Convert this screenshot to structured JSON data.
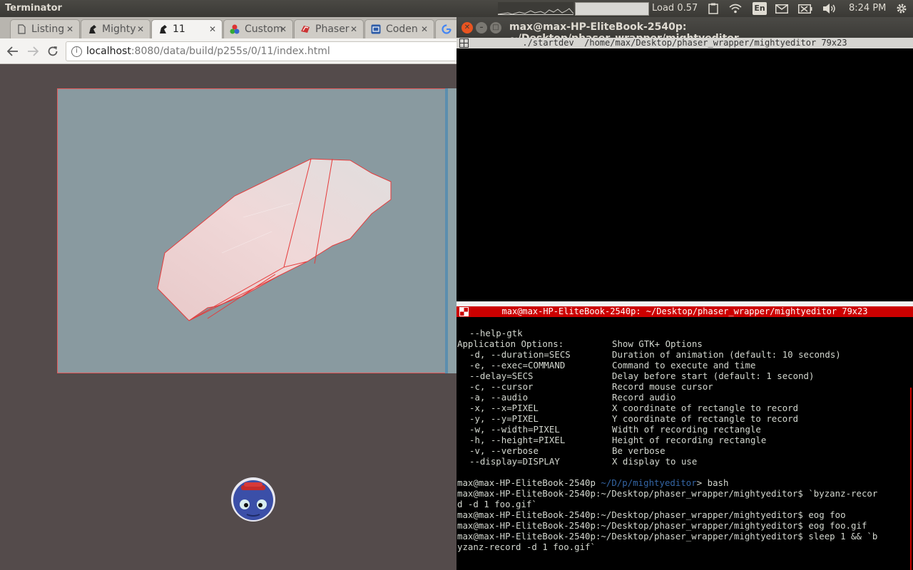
{
  "panel": {
    "app_title": "Terminator",
    "load": "Load 0.57",
    "keyboard": "En",
    "clock": "8:24 PM"
  },
  "browser": {
    "tabs": [
      {
        "label": "Listing",
        "icon": "page-icon"
      },
      {
        "label": "Mighty",
        "icon": "mightyeditor-icon"
      },
      {
        "label": "11",
        "icon": "mightyeditor-icon",
        "active": true
      },
      {
        "label": "Custom",
        "icon": "colorful-icon"
      },
      {
        "label": "Phaser",
        "icon": "phaser-icon"
      },
      {
        "label": "Coden",
        "icon": "codepen-icon"
      },
      {
        "label": "",
        "icon": "google-icon"
      }
    ],
    "url_host": "localhost",
    "url_path": ":8080/data/build/p255s/0/11/index.html"
  },
  "terminal": {
    "window_title": "max@max-HP-EliteBook-2540p: ~/Desktop/phaser_wrapper/mightyeditor",
    "pane1_header": "./startdev  /home/max/Desktop/phaser_wrapper/mightyeditor 79x23",
    "pane2_header": "max@max-HP-EliteBook-2540p: ~/Desktop/phaser_wrapper/mightyeditor 79x23",
    "help_line": {
      "opt": "--help-gtk",
      "desc": "Show GTK+ Options"
    },
    "app_options_heading": "Application Options:",
    "options": [
      {
        "opt": "-d, --duration=SECS",
        "desc": "Duration of animation (default: 10 seconds)"
      },
      {
        "opt": "-e, --exec=COMMAND",
        "desc": "Command to execute and time"
      },
      {
        "opt": "--delay=SECS",
        "desc": "Delay before start (default: 1 second)"
      },
      {
        "opt": "-c, --cursor",
        "desc": "Record mouse cursor"
      },
      {
        "opt": "-a, --audio",
        "desc": "Record audio"
      },
      {
        "opt": "-x, --x=PIXEL",
        "desc": "X coordinate of rectangle to record"
      },
      {
        "opt": "-y, --y=PIXEL",
        "desc": "Y coordinate of rectangle to record"
      },
      {
        "opt": "-w, --width=PIXEL",
        "desc": "Width of recording rectangle"
      },
      {
        "opt": "-h, --height=PIXEL",
        "desc": "Height of recording rectangle"
      },
      {
        "opt": "-v, --verbose",
        "desc": "Be verbose"
      },
      {
        "opt": "--display=DISPLAY",
        "desc": "X display to use"
      }
    ],
    "fish_prompt_host": "max@max-HP-EliteBook-2540p",
    "fish_prompt_path": " ~/D/p/mightyeditor",
    "fish_prompt_cmd": "> bash",
    "history": [
      "max@max-HP-EliteBook-2540p:~/Desktop/phaser_wrapper/mightyeditor$ `byzanz-recor",
      "d -d 1 foo.gif`",
      "max@max-HP-EliteBook-2540p:~/Desktop/phaser_wrapper/mightyeditor$ eog foo",
      "max@max-HP-EliteBook-2540p:~/Desktop/phaser_wrapper/mightyeditor$ eog foo.gif",
      "max@max-HP-EliteBook-2540p:~/Desktop/phaser_wrapper/mightyeditor$ sleep 1 && `b",
      "yzanz-record -d 1 foo.gif`"
    ]
  },
  "colors": {
    "terminal_bg": "#000000",
    "active_pane_header": "#cc0000",
    "canvas_bg": "#899aa0",
    "page_bg": "#544b4b",
    "prompt_path": "#3465a4"
  }
}
